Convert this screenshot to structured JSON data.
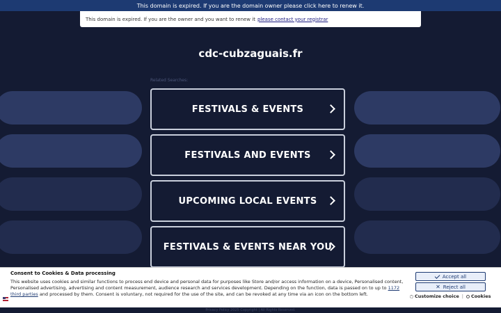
{
  "topbar": {
    "text": "This domain is expired. If you are the domain owner please click here to renew it."
  },
  "notice": {
    "text": "This domain is expired. If you are the owner and you want to renew it",
    "link": "please contact your registrar"
  },
  "domain": "cdc-cubzaguais.fr",
  "related_label": "Related Searches:",
  "links": [
    {
      "label": "FESTIVALS & EVENTS"
    },
    {
      "label": "FESTIVALS AND EVENTS"
    },
    {
      "label": "UPCOMING LOCAL EVENTS"
    },
    {
      "label": "FESTIVALS & EVENTS NEAR YOU"
    }
  ],
  "footer": {
    "text": "Privacy Policy  2025 Copyright | All Rights Reserved."
  },
  "cookie": {
    "title": "Consent to Cookies & Data processing",
    "text_before": "This website uses cookies and similar functions to process end device and personal data for purposes like Store and/or access information on a device, Personalised content, Personalised advertising, advertising and content measurement, audience research and services development. Depending on the function, data is passed on to up to",
    "third_parties": "1172 third parties",
    "text_after": "and processed by them. Consent is voluntary, not required for the use of the site, and can be revoked at any time via an icon on the bottom left.",
    "accept": "Accept all",
    "reject": "Reject all",
    "customize": "Customize choice",
    "separator": "|",
    "cookies": "Cookies"
  },
  "colors": {
    "background": "#141b33",
    "topbar": "#1d3a72",
    "deco": "#2d3a64",
    "border": "#c9cfdc"
  }
}
